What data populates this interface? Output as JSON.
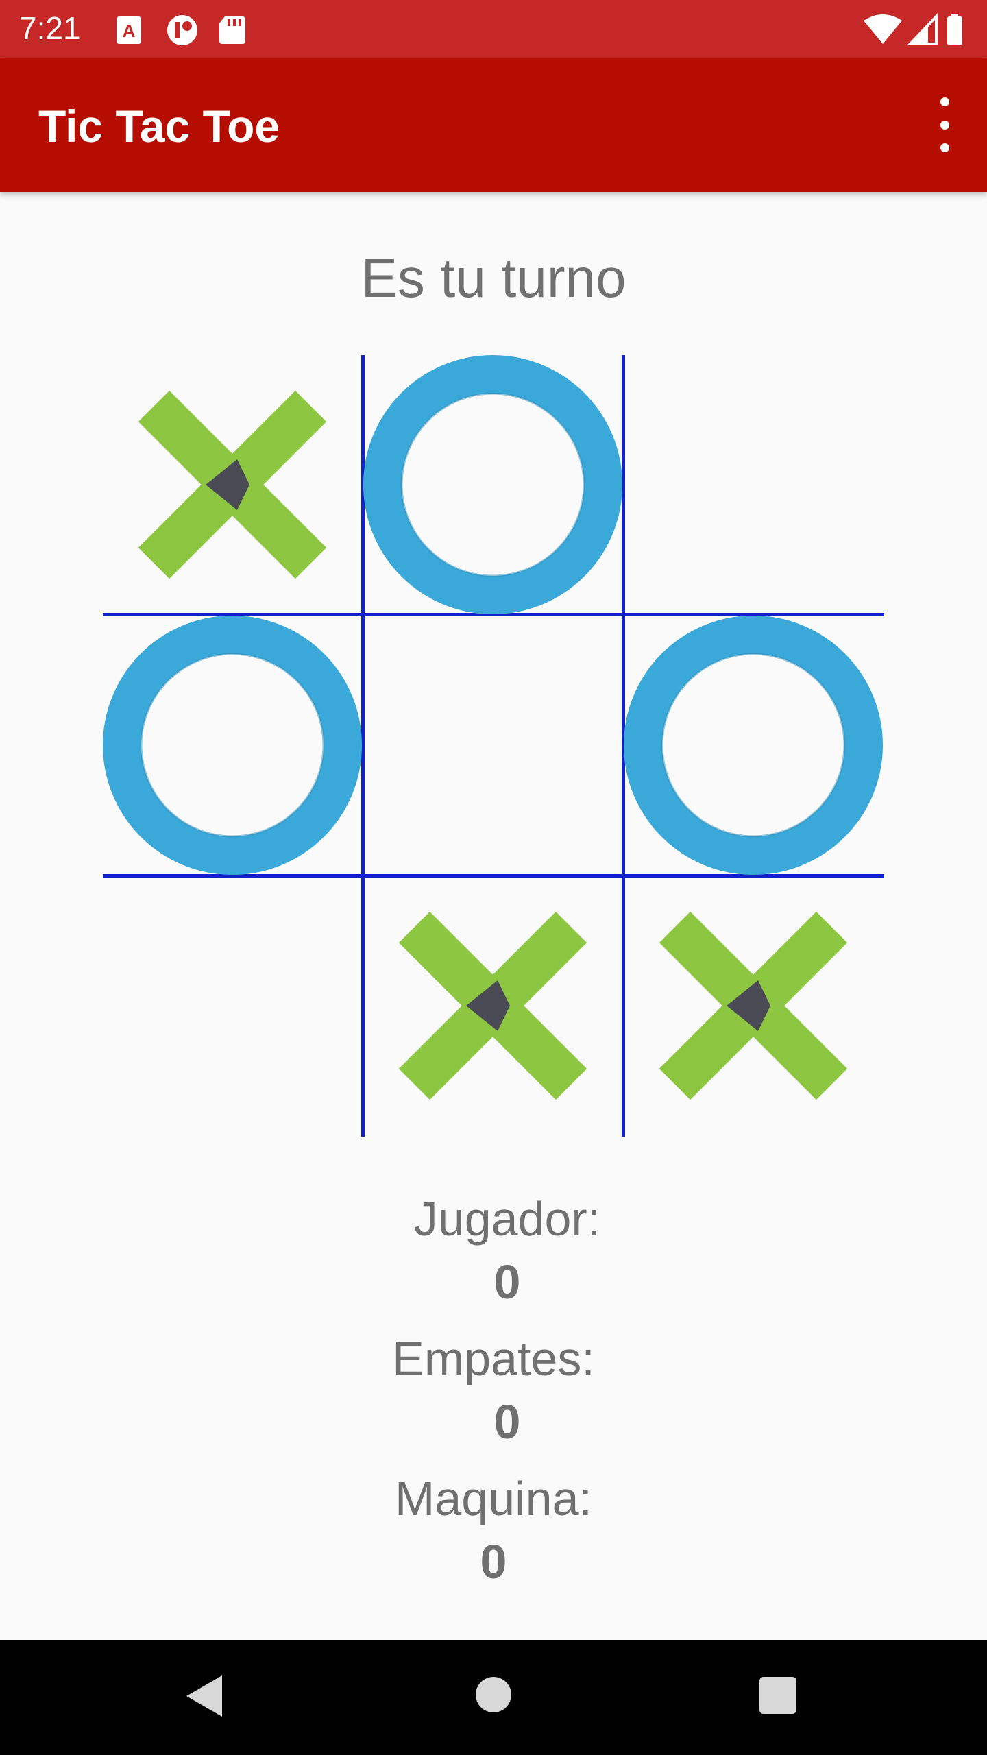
{
  "status_bar": {
    "time": "7:21",
    "left_icons": [
      "a-notification-icon",
      "app-notification-icon",
      "sd-card-icon"
    ],
    "right_icons": [
      "wifi-icon",
      "signal-icon",
      "battery-icon"
    ]
  },
  "app_bar": {
    "title": "Tic Tac Toe",
    "menu_icon": "more-vert-icon"
  },
  "game": {
    "turn_text": "Es tu turno",
    "board": [
      [
        "X",
        "O",
        ""
      ],
      [
        "O",
        "",
        "O"
      ],
      [
        "",
        "X",
        "X"
      ]
    ]
  },
  "scores": {
    "player_label": "Jugador:",
    "player_value": "0",
    "ties_label": "Empates:",
    "ties_value": "0",
    "machine_label": "Maquina:",
    "machine_value": "0"
  },
  "nav_bar": {
    "icons": [
      "back-icon",
      "home-icon",
      "recents-icon"
    ]
  },
  "colors": {
    "status_bar": "#c62828",
    "app_bar": "#b50d00",
    "x_mark": "#8dc641",
    "o_mark": "#3aa8d8",
    "grid": "#1122cc"
  }
}
